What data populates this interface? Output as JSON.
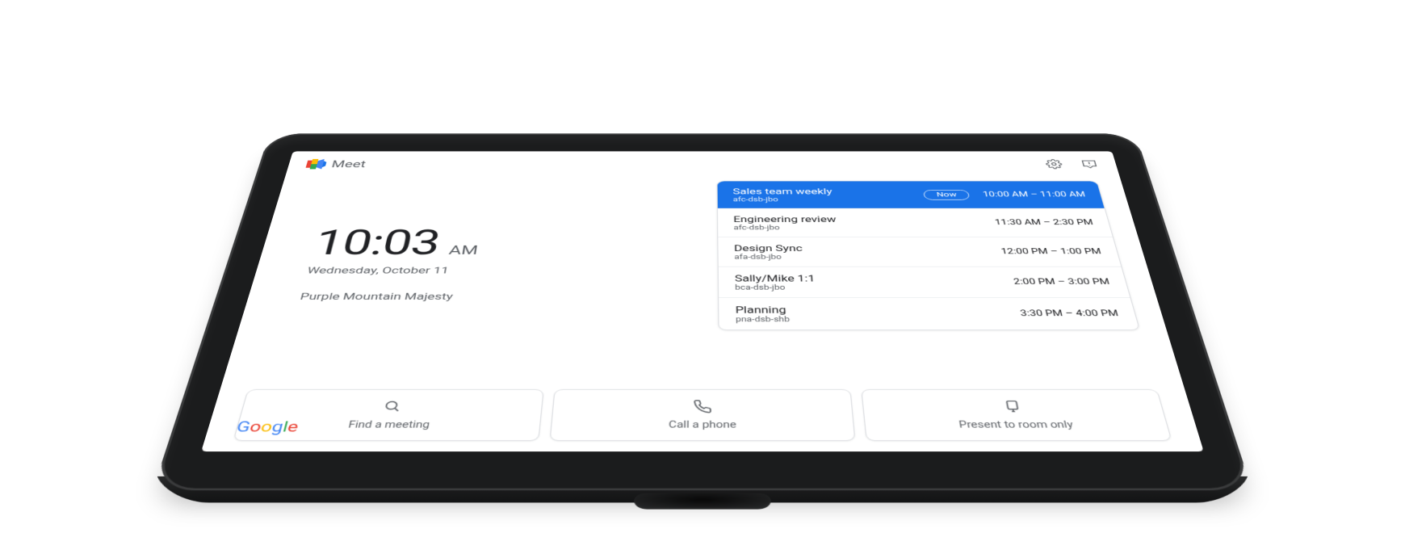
{
  "app": {
    "name": "Meet"
  },
  "topbar": {
    "settings_icon": "settings",
    "feedback_icon": "feedback"
  },
  "clock": {
    "time": "10:03",
    "ampm": "AM",
    "date": "Wednesday, October 11",
    "room": "Purple Mountain Majesty"
  },
  "agenda": [
    {
      "title": "Sales team weekly",
      "code": "afc-dsb-jbo",
      "time": "10:00 AM – 11:00 AM",
      "now": true,
      "now_label": "Now"
    },
    {
      "title": "Engineering review",
      "code": "afc-dsb-jbo",
      "time": "11:30 AM – 2:30 PM",
      "now": false
    },
    {
      "title": "Design Sync",
      "code": "afa-dsb-jbo",
      "time": "12:00 PM – 1:00 PM",
      "now": false
    },
    {
      "title": "Sally/Mike 1:1",
      "code": "bca-dsb-jbo",
      "time": "2:00 PM – 3:00 PM",
      "now": false
    },
    {
      "title": "Planning",
      "code": "pna-dsb-shb",
      "time": "3:30 PM – 4:00 PM",
      "now": false
    }
  ],
  "actions": {
    "find": {
      "label": "Find a meeting"
    },
    "call": {
      "label": "Call a phone"
    },
    "present": {
      "label": "Present to room only"
    }
  },
  "brand": {
    "g1": "G",
    "g2": "o",
    "g3": "o",
    "g4": "g",
    "g5": "l",
    "g6": "e"
  }
}
